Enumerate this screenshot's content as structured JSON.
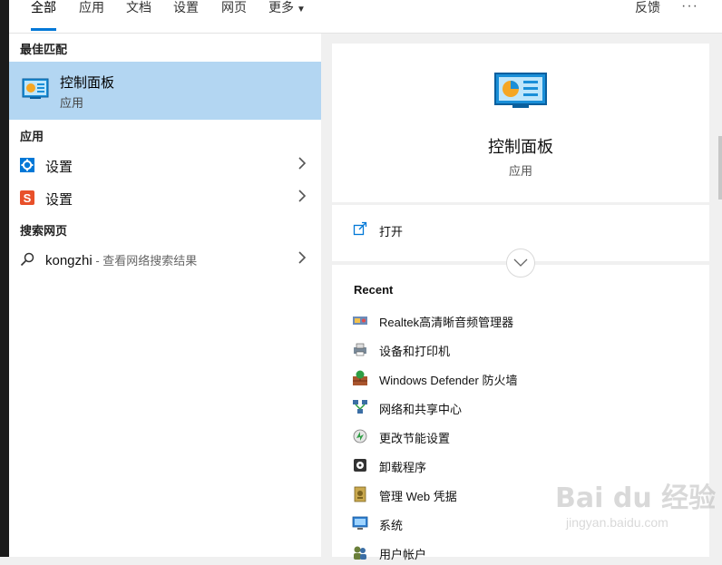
{
  "tabs": [
    {
      "label": "全部",
      "active": true
    },
    {
      "label": "应用",
      "active": false
    },
    {
      "label": "文档",
      "active": false
    },
    {
      "label": "设置",
      "active": false
    },
    {
      "label": "网页",
      "active": false
    },
    {
      "label": "更多",
      "active": false,
      "has_dropdown": true
    }
  ],
  "header": {
    "feedback_label": "反馈",
    "more_icon": "ellipsis-icon"
  },
  "left": {
    "best_match_header": "最佳匹配",
    "best_match": {
      "title": "控制面板",
      "subtitle": "应用",
      "icon": "control-panel-icon"
    },
    "apps_header": "应用",
    "apps": [
      {
        "label": "设置",
        "icon": "gear-icon"
      },
      {
        "label": "设置",
        "icon": "sogou-s-icon"
      }
    ],
    "web_header": "搜索网页",
    "web": {
      "query": "kongzhi",
      "desc": " - 查看网络搜索结果",
      "icon": "search-icon"
    }
  },
  "detail": {
    "title": "控制面板",
    "subtitle": "应用",
    "open_label": "打开",
    "recent_header": "Recent",
    "recent": [
      {
        "label": "Realtek高清晰音频管理器",
        "icon": "audio-manager-icon"
      },
      {
        "label": "设备和打印机",
        "icon": "printer-icon"
      },
      {
        "label": "Windows Defender 防火墙",
        "icon": "firewall-icon"
      },
      {
        "label": "网络和共享中心",
        "icon": "network-icon"
      },
      {
        "label": "更改节能设置",
        "icon": "power-icon"
      },
      {
        "label": "卸载程序",
        "icon": "uninstall-icon"
      },
      {
        "label": "管理 Web 凭据",
        "icon": "credential-icon"
      },
      {
        "label": "系统",
        "icon": "system-monitor-icon"
      },
      {
        "label": "用户帐户",
        "icon": "users-icon"
      }
    ]
  },
  "watermark": {
    "brand": "Bai du 经验",
    "url": "jingyan.baidu.com"
  },
  "colors": {
    "accent": "#0078d7",
    "selection": "#b3d6f2"
  }
}
